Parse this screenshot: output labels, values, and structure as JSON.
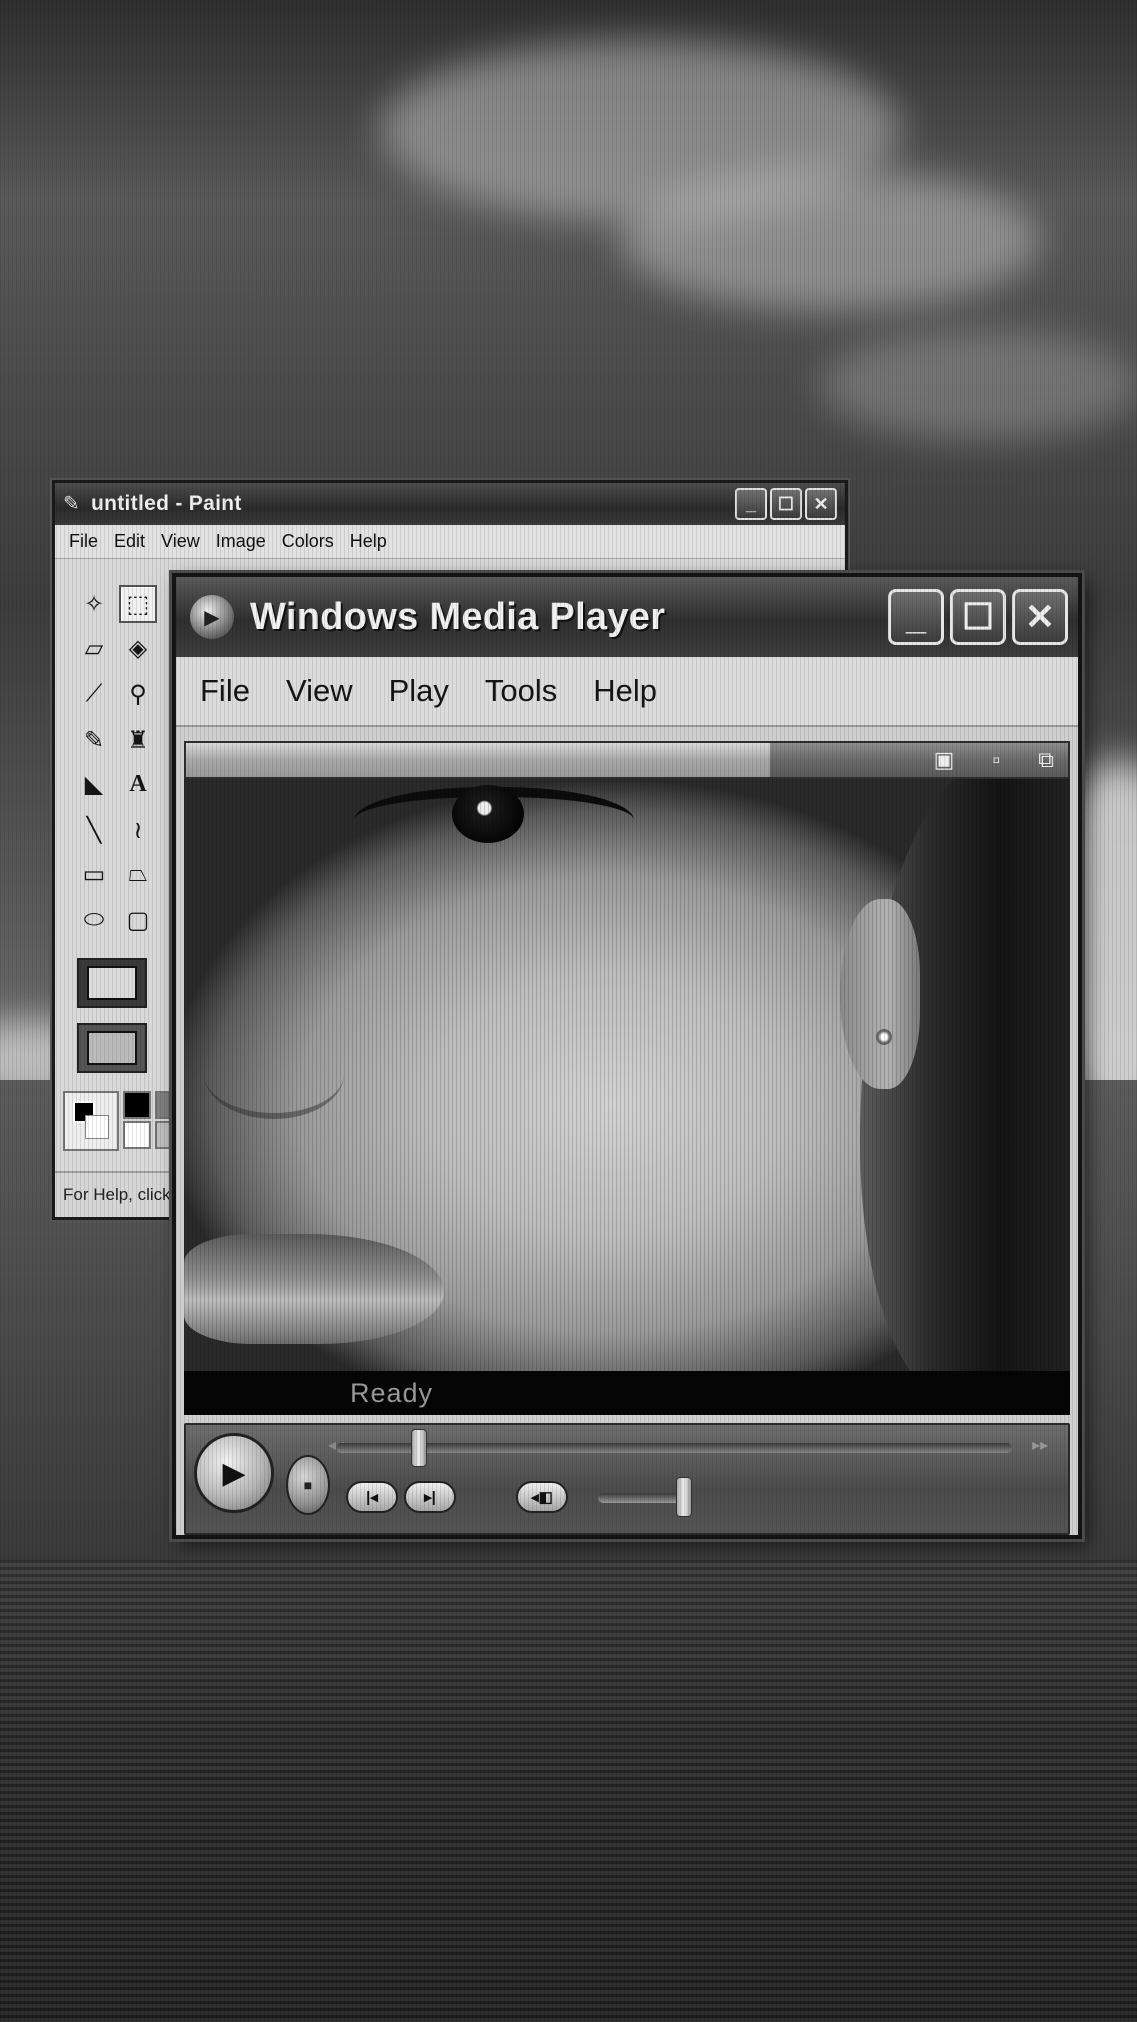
{
  "paint": {
    "title": "untitled - Paint",
    "menu": [
      "File",
      "Edit",
      "View",
      "Image",
      "Colors",
      "Help"
    ],
    "status": "For Help, click"
  },
  "wmp": {
    "title": "Windows Media Player",
    "menu": [
      "File",
      "View",
      "Play",
      "Tools",
      "Help"
    ],
    "status": "Ready",
    "seek_progress_percent": 20,
    "volume_percent": 85
  },
  "icons": {
    "paint_app": "paint-brush-icon",
    "wmp_app": "media-player-logo-icon",
    "minimize": "minimize-icon",
    "maximize": "maximize-icon",
    "close": "close-icon"
  },
  "colors": {
    "title_bar": "#2f2f2f",
    "window_face": "#d9d9d9",
    "status_bar_bg": "#050505",
    "status_text": "#9a9a9a"
  }
}
